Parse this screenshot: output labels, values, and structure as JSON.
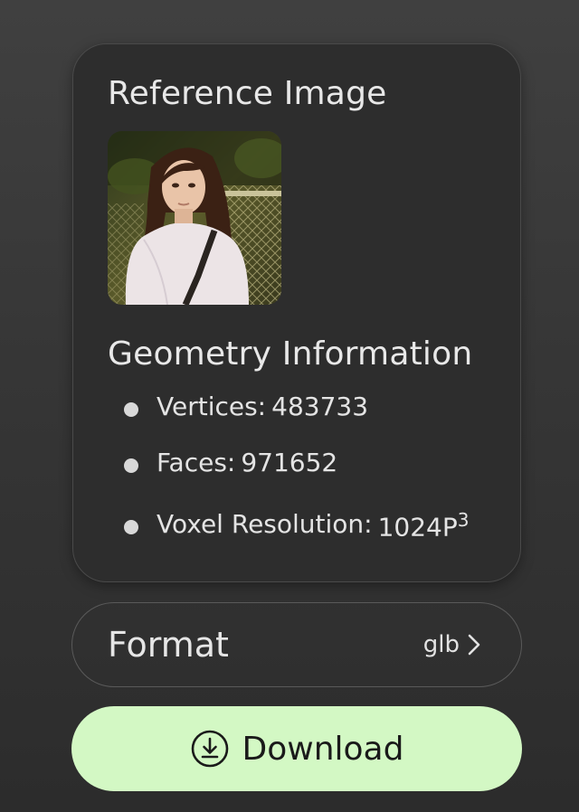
{
  "reference": {
    "title": "Reference Image"
  },
  "geometry": {
    "title": "Geometry Information",
    "vertices_label": "Vertices:",
    "vertices_value": "483733",
    "faces_label": "Faces:",
    "faces_value": "971652",
    "resolution_label": "Voxel Resolution:",
    "resolution_value": "1024P",
    "resolution_exponent": "3"
  },
  "format": {
    "label": "Format",
    "value": "glb"
  },
  "download": {
    "label": "Download"
  },
  "colors": {
    "accent": "#d3f8c4",
    "card": "#2d2d2d"
  },
  "icons": [
    "chevron-right-icon",
    "download-icon"
  ]
}
